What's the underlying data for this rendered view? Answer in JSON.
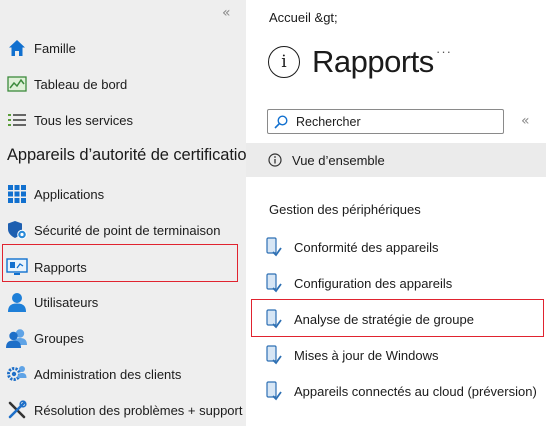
{
  "sidebar": {
    "collapse_glyph": "«",
    "items_top": [
      {
        "label": "Famille",
        "icon": "home-icon"
      },
      {
        "label": "Tableau de bord",
        "icon": "dashboard-icon"
      },
      {
        "label": "Tous les services",
        "icon": "list-icon"
      }
    ],
    "section_header": "Appareils d’autorité de certification",
    "items": [
      {
        "label": "Applications",
        "icon": "apps-grid-icon"
      },
      {
        "label": "Sécurité de point de terminaison",
        "icon": "shield-icon"
      },
      {
        "label": "Rapports",
        "icon": "reports-monitor-icon",
        "highlighted": true
      },
      {
        "label": "Utilisateurs",
        "icon": "user-icon"
      },
      {
        "label": "Groupes",
        "icon": "group-icon"
      },
      {
        "label": "Administration des clients",
        "icon": "gear-people-icon"
      },
      {
        "label": "Résolution des problèmes + support",
        "icon": "wrench-icon"
      }
    ]
  },
  "main": {
    "breadcrumb": "Accueil &gt;",
    "title_icon": "i",
    "title": "Rapports",
    "more_glyph": "···",
    "search": {
      "placeholder": "Rechercher"
    },
    "collapse_glyph": "«",
    "overview_label": "Vue d’ensemble",
    "group_header": "Gestion des périphériques",
    "group_items": [
      {
        "label": "Conformité des appareils"
      },
      {
        "label": "Configuration des appareils"
      },
      {
        "label": "Analyse de stratégie de groupe",
        "highlighted": true
      },
      {
        "label": "Mises à jour de Windows"
      },
      {
        "label": "Appareils connectés au cloud (préversion)"
      }
    ]
  },
  "colors": {
    "accent": "#0078d4",
    "highlight_border": "#e0232f",
    "sidebar_bg": "#eeeeee"
  }
}
